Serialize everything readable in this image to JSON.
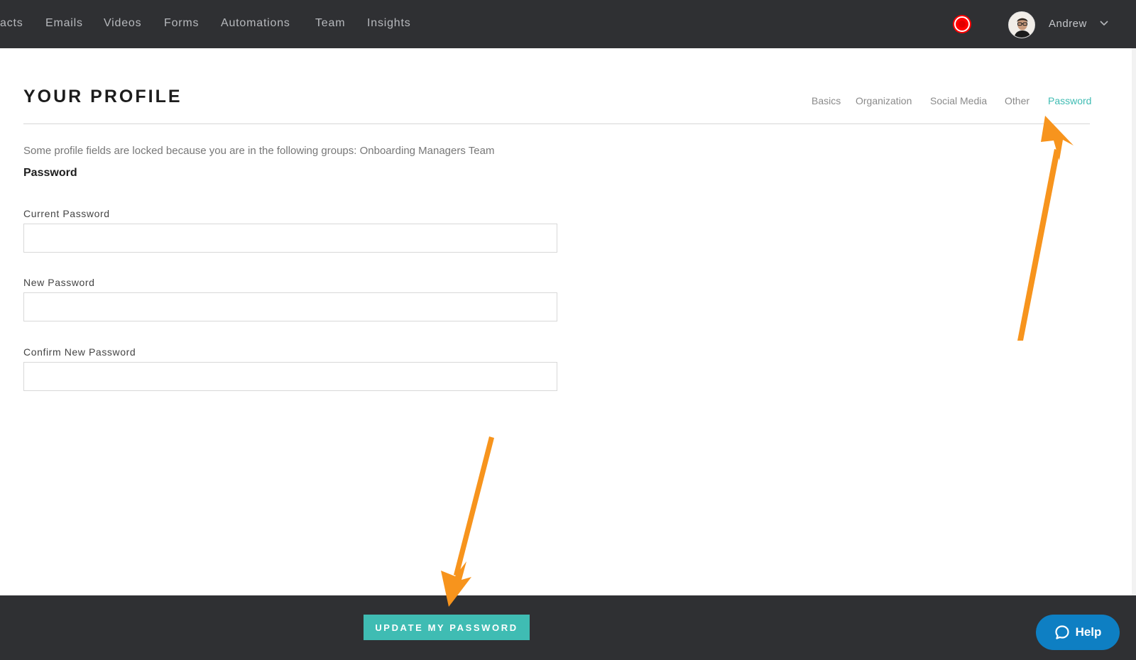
{
  "nav": {
    "items": [
      "acts",
      "Emails",
      "Videos",
      "Forms",
      "Automations",
      "Team",
      "Insights"
    ],
    "user_name": "Andrew"
  },
  "icons": {
    "record": "record-icon",
    "avatar": "avatar",
    "chevron": "chevron-down-icon",
    "help": "chat-bubble-icon"
  },
  "page": {
    "title": "YOUR PROFILE",
    "tabs": [
      "Basics",
      "Organization",
      "Social Media",
      "Other",
      "Password"
    ],
    "active_tab": "Password",
    "notice": "Some profile fields are locked because you are in the following groups: Onboarding Managers Team",
    "section_title": "Password"
  },
  "form": {
    "current_password": {
      "label": "Current Password",
      "value": "",
      "placeholder": ""
    },
    "new_password": {
      "label": "New Password",
      "value": "",
      "placeholder": ""
    },
    "confirm_password": {
      "label": "Confirm New Password",
      "value": "",
      "placeholder": ""
    }
  },
  "footer": {
    "update_label": "UPDATE MY PASSWORD",
    "help_label": "Help"
  },
  "colors": {
    "accent": "#3fbcb3",
    "nav_bg": "#2f3033",
    "help_blue": "#0e7fc3",
    "annotation_arrow": "#f7941d",
    "record_red": "#ff0000"
  }
}
